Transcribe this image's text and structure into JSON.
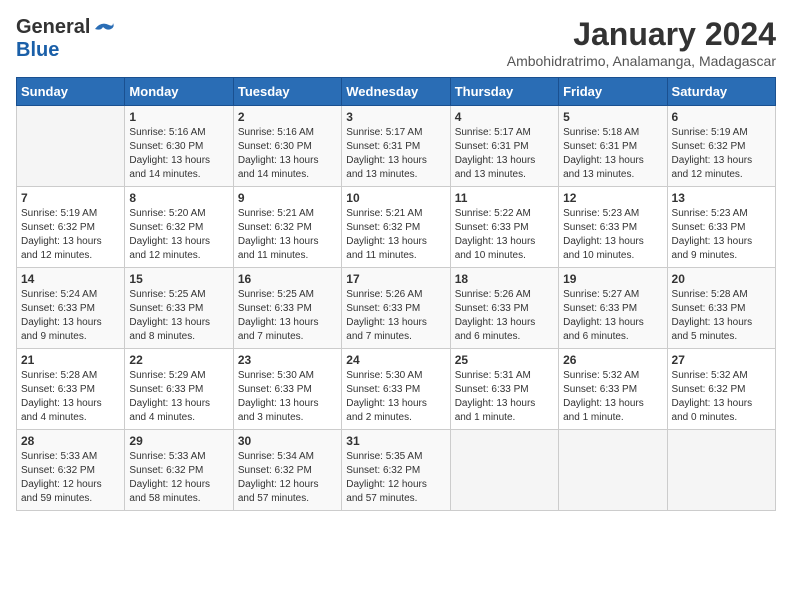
{
  "logo": {
    "general": "General",
    "blue": "Blue"
  },
  "title": {
    "month_year": "January 2024",
    "location": "Ambohidratrimo, Analamanga, Madagascar"
  },
  "days_header": [
    "Sunday",
    "Monday",
    "Tuesday",
    "Wednesday",
    "Thursday",
    "Friday",
    "Saturday"
  ],
  "weeks": [
    [
      {
        "day": "",
        "info": ""
      },
      {
        "day": "1",
        "info": "Sunrise: 5:16 AM\nSunset: 6:30 PM\nDaylight: 13 hours\nand 14 minutes."
      },
      {
        "day": "2",
        "info": "Sunrise: 5:16 AM\nSunset: 6:30 PM\nDaylight: 13 hours\nand 14 minutes."
      },
      {
        "day": "3",
        "info": "Sunrise: 5:17 AM\nSunset: 6:31 PM\nDaylight: 13 hours\nand 13 minutes."
      },
      {
        "day": "4",
        "info": "Sunrise: 5:17 AM\nSunset: 6:31 PM\nDaylight: 13 hours\nand 13 minutes."
      },
      {
        "day": "5",
        "info": "Sunrise: 5:18 AM\nSunset: 6:31 PM\nDaylight: 13 hours\nand 13 minutes."
      },
      {
        "day": "6",
        "info": "Sunrise: 5:19 AM\nSunset: 6:32 PM\nDaylight: 13 hours\nand 12 minutes."
      }
    ],
    [
      {
        "day": "7",
        "info": "Sunrise: 5:19 AM\nSunset: 6:32 PM\nDaylight: 13 hours\nand 12 minutes."
      },
      {
        "day": "8",
        "info": "Sunrise: 5:20 AM\nSunset: 6:32 PM\nDaylight: 13 hours\nand 12 minutes."
      },
      {
        "day": "9",
        "info": "Sunrise: 5:21 AM\nSunset: 6:32 PM\nDaylight: 13 hours\nand 11 minutes."
      },
      {
        "day": "10",
        "info": "Sunrise: 5:21 AM\nSunset: 6:32 PM\nDaylight: 13 hours\nand 11 minutes."
      },
      {
        "day": "11",
        "info": "Sunrise: 5:22 AM\nSunset: 6:33 PM\nDaylight: 13 hours\nand 10 minutes."
      },
      {
        "day": "12",
        "info": "Sunrise: 5:23 AM\nSunset: 6:33 PM\nDaylight: 13 hours\nand 10 minutes."
      },
      {
        "day": "13",
        "info": "Sunrise: 5:23 AM\nSunset: 6:33 PM\nDaylight: 13 hours\nand 9 minutes."
      }
    ],
    [
      {
        "day": "14",
        "info": "Sunrise: 5:24 AM\nSunset: 6:33 PM\nDaylight: 13 hours\nand 9 minutes."
      },
      {
        "day": "15",
        "info": "Sunrise: 5:25 AM\nSunset: 6:33 PM\nDaylight: 13 hours\nand 8 minutes."
      },
      {
        "day": "16",
        "info": "Sunrise: 5:25 AM\nSunset: 6:33 PM\nDaylight: 13 hours\nand 7 minutes."
      },
      {
        "day": "17",
        "info": "Sunrise: 5:26 AM\nSunset: 6:33 PM\nDaylight: 13 hours\nand 7 minutes."
      },
      {
        "day": "18",
        "info": "Sunrise: 5:26 AM\nSunset: 6:33 PM\nDaylight: 13 hours\nand 6 minutes."
      },
      {
        "day": "19",
        "info": "Sunrise: 5:27 AM\nSunset: 6:33 PM\nDaylight: 13 hours\nand 6 minutes."
      },
      {
        "day": "20",
        "info": "Sunrise: 5:28 AM\nSunset: 6:33 PM\nDaylight: 13 hours\nand 5 minutes."
      }
    ],
    [
      {
        "day": "21",
        "info": "Sunrise: 5:28 AM\nSunset: 6:33 PM\nDaylight: 13 hours\nand 4 minutes."
      },
      {
        "day": "22",
        "info": "Sunrise: 5:29 AM\nSunset: 6:33 PM\nDaylight: 13 hours\nand 4 minutes."
      },
      {
        "day": "23",
        "info": "Sunrise: 5:30 AM\nSunset: 6:33 PM\nDaylight: 13 hours\nand 3 minutes."
      },
      {
        "day": "24",
        "info": "Sunrise: 5:30 AM\nSunset: 6:33 PM\nDaylight: 13 hours\nand 2 minutes."
      },
      {
        "day": "25",
        "info": "Sunrise: 5:31 AM\nSunset: 6:33 PM\nDaylight: 13 hours\nand 1 minute."
      },
      {
        "day": "26",
        "info": "Sunrise: 5:32 AM\nSunset: 6:33 PM\nDaylight: 13 hours\nand 1 minute."
      },
      {
        "day": "27",
        "info": "Sunrise: 5:32 AM\nSunset: 6:32 PM\nDaylight: 13 hours\nand 0 minutes."
      }
    ],
    [
      {
        "day": "28",
        "info": "Sunrise: 5:33 AM\nSunset: 6:32 PM\nDaylight: 12 hours\nand 59 minutes."
      },
      {
        "day": "29",
        "info": "Sunrise: 5:33 AM\nSunset: 6:32 PM\nDaylight: 12 hours\nand 58 minutes."
      },
      {
        "day": "30",
        "info": "Sunrise: 5:34 AM\nSunset: 6:32 PM\nDaylight: 12 hours\nand 57 minutes."
      },
      {
        "day": "31",
        "info": "Sunrise: 5:35 AM\nSunset: 6:32 PM\nDaylight: 12 hours\nand 57 minutes."
      },
      {
        "day": "",
        "info": ""
      },
      {
        "day": "",
        "info": ""
      },
      {
        "day": "",
        "info": ""
      }
    ]
  ]
}
